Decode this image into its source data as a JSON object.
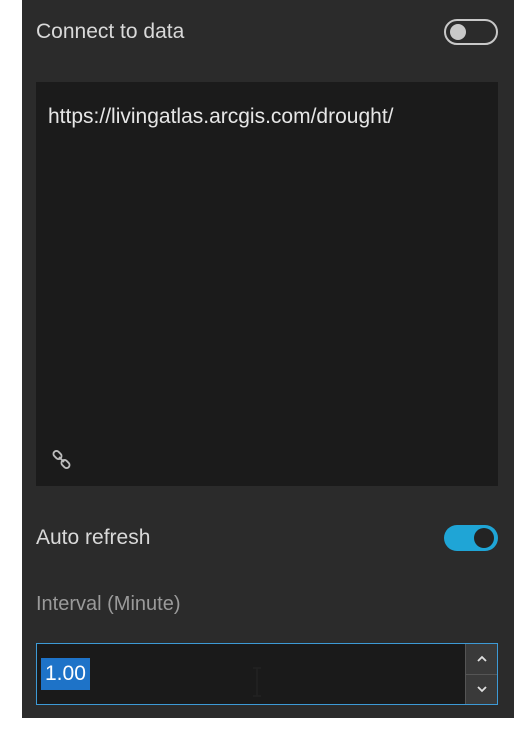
{
  "connect": {
    "label": "Connect to data",
    "toggle_state": "off"
  },
  "url": {
    "value": "https://livingatlas.arcgis.com/drought/",
    "icon": "link-icon"
  },
  "auto_refresh": {
    "label": "Auto refresh",
    "toggle_state": "on"
  },
  "interval": {
    "label": "Interval (Minute)",
    "value": "1.00",
    "increment_icon": "chevron-up-icon",
    "decrement_icon": "chevron-down-icon"
  },
  "colors": {
    "panel_bg": "#2b2b2b",
    "input_bg": "#1b1b1b",
    "accent": "#1fa5d6",
    "selection": "#1e73c8"
  }
}
